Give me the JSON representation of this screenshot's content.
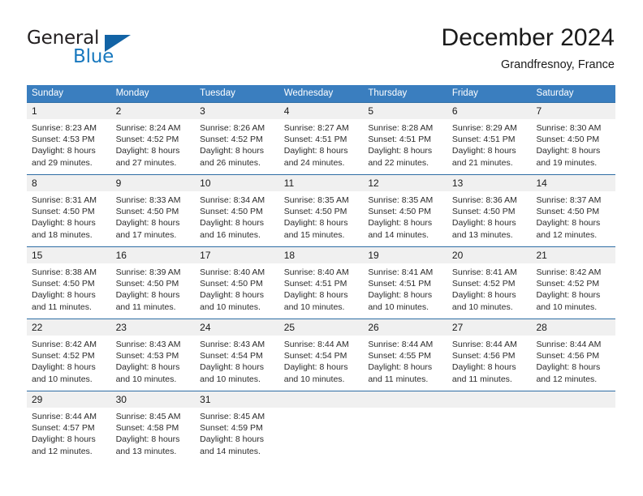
{
  "brand": {
    "name_part1": "General",
    "name_part2": "Blue",
    "colors": {
      "general": "#231f20",
      "blue": "#1878be",
      "triangle": "#1263a5",
      "header_bar": "#3a7ebf",
      "row_separator": "#2e6da4",
      "daynum_band": "#f0f0f0"
    }
  },
  "header": {
    "title": "December 2024",
    "subtitle": "Grandfresnoy, France"
  },
  "weekdays": [
    "Sunday",
    "Monday",
    "Tuesday",
    "Wednesday",
    "Thursday",
    "Friday",
    "Saturday"
  ],
  "weeks": [
    [
      {
        "day": "1",
        "sunrise": "Sunrise: 8:23 AM",
        "sunset": "Sunset: 4:53 PM",
        "daylight1": "Daylight: 8 hours",
        "daylight2": "and 29 minutes."
      },
      {
        "day": "2",
        "sunrise": "Sunrise: 8:24 AM",
        "sunset": "Sunset: 4:52 PM",
        "daylight1": "Daylight: 8 hours",
        "daylight2": "and 27 minutes."
      },
      {
        "day": "3",
        "sunrise": "Sunrise: 8:26 AM",
        "sunset": "Sunset: 4:52 PM",
        "daylight1": "Daylight: 8 hours",
        "daylight2": "and 26 minutes."
      },
      {
        "day": "4",
        "sunrise": "Sunrise: 8:27 AM",
        "sunset": "Sunset: 4:51 PM",
        "daylight1": "Daylight: 8 hours",
        "daylight2": "and 24 minutes."
      },
      {
        "day": "5",
        "sunrise": "Sunrise: 8:28 AM",
        "sunset": "Sunset: 4:51 PM",
        "daylight1": "Daylight: 8 hours",
        "daylight2": "and 22 minutes."
      },
      {
        "day": "6",
        "sunrise": "Sunrise: 8:29 AM",
        "sunset": "Sunset: 4:51 PM",
        "daylight1": "Daylight: 8 hours",
        "daylight2": "and 21 minutes."
      },
      {
        "day": "7",
        "sunrise": "Sunrise: 8:30 AM",
        "sunset": "Sunset: 4:50 PM",
        "daylight1": "Daylight: 8 hours",
        "daylight2": "and 19 minutes."
      }
    ],
    [
      {
        "day": "8",
        "sunrise": "Sunrise: 8:31 AM",
        "sunset": "Sunset: 4:50 PM",
        "daylight1": "Daylight: 8 hours",
        "daylight2": "and 18 minutes."
      },
      {
        "day": "9",
        "sunrise": "Sunrise: 8:33 AM",
        "sunset": "Sunset: 4:50 PM",
        "daylight1": "Daylight: 8 hours",
        "daylight2": "and 17 minutes."
      },
      {
        "day": "10",
        "sunrise": "Sunrise: 8:34 AM",
        "sunset": "Sunset: 4:50 PM",
        "daylight1": "Daylight: 8 hours",
        "daylight2": "and 16 minutes."
      },
      {
        "day": "11",
        "sunrise": "Sunrise: 8:35 AM",
        "sunset": "Sunset: 4:50 PM",
        "daylight1": "Daylight: 8 hours",
        "daylight2": "and 15 minutes."
      },
      {
        "day": "12",
        "sunrise": "Sunrise: 8:35 AM",
        "sunset": "Sunset: 4:50 PM",
        "daylight1": "Daylight: 8 hours",
        "daylight2": "and 14 minutes."
      },
      {
        "day": "13",
        "sunrise": "Sunrise: 8:36 AM",
        "sunset": "Sunset: 4:50 PM",
        "daylight1": "Daylight: 8 hours",
        "daylight2": "and 13 minutes."
      },
      {
        "day": "14",
        "sunrise": "Sunrise: 8:37 AM",
        "sunset": "Sunset: 4:50 PM",
        "daylight1": "Daylight: 8 hours",
        "daylight2": "and 12 minutes."
      }
    ],
    [
      {
        "day": "15",
        "sunrise": "Sunrise: 8:38 AM",
        "sunset": "Sunset: 4:50 PM",
        "daylight1": "Daylight: 8 hours",
        "daylight2": "and 11 minutes."
      },
      {
        "day": "16",
        "sunrise": "Sunrise: 8:39 AM",
        "sunset": "Sunset: 4:50 PM",
        "daylight1": "Daylight: 8 hours",
        "daylight2": "and 11 minutes."
      },
      {
        "day": "17",
        "sunrise": "Sunrise: 8:40 AM",
        "sunset": "Sunset: 4:50 PM",
        "daylight1": "Daylight: 8 hours",
        "daylight2": "and 10 minutes."
      },
      {
        "day": "18",
        "sunrise": "Sunrise: 8:40 AM",
        "sunset": "Sunset: 4:51 PM",
        "daylight1": "Daylight: 8 hours",
        "daylight2": "and 10 minutes."
      },
      {
        "day": "19",
        "sunrise": "Sunrise: 8:41 AM",
        "sunset": "Sunset: 4:51 PM",
        "daylight1": "Daylight: 8 hours",
        "daylight2": "and 10 minutes."
      },
      {
        "day": "20",
        "sunrise": "Sunrise: 8:41 AM",
        "sunset": "Sunset: 4:52 PM",
        "daylight1": "Daylight: 8 hours",
        "daylight2": "and 10 minutes."
      },
      {
        "day": "21",
        "sunrise": "Sunrise: 8:42 AM",
        "sunset": "Sunset: 4:52 PM",
        "daylight1": "Daylight: 8 hours",
        "daylight2": "and 10 minutes."
      }
    ],
    [
      {
        "day": "22",
        "sunrise": "Sunrise: 8:42 AM",
        "sunset": "Sunset: 4:52 PM",
        "daylight1": "Daylight: 8 hours",
        "daylight2": "and 10 minutes."
      },
      {
        "day": "23",
        "sunrise": "Sunrise: 8:43 AM",
        "sunset": "Sunset: 4:53 PM",
        "daylight1": "Daylight: 8 hours",
        "daylight2": "and 10 minutes."
      },
      {
        "day": "24",
        "sunrise": "Sunrise: 8:43 AM",
        "sunset": "Sunset: 4:54 PM",
        "daylight1": "Daylight: 8 hours",
        "daylight2": "and 10 minutes."
      },
      {
        "day": "25",
        "sunrise": "Sunrise: 8:44 AM",
        "sunset": "Sunset: 4:54 PM",
        "daylight1": "Daylight: 8 hours",
        "daylight2": "and 10 minutes."
      },
      {
        "day": "26",
        "sunrise": "Sunrise: 8:44 AM",
        "sunset": "Sunset: 4:55 PM",
        "daylight1": "Daylight: 8 hours",
        "daylight2": "and 11 minutes."
      },
      {
        "day": "27",
        "sunrise": "Sunrise: 8:44 AM",
        "sunset": "Sunset: 4:56 PM",
        "daylight1": "Daylight: 8 hours",
        "daylight2": "and 11 minutes."
      },
      {
        "day": "28",
        "sunrise": "Sunrise: 8:44 AM",
        "sunset": "Sunset: 4:56 PM",
        "daylight1": "Daylight: 8 hours",
        "daylight2": "and 12 minutes."
      }
    ],
    [
      {
        "day": "29",
        "sunrise": "Sunrise: 8:44 AM",
        "sunset": "Sunset: 4:57 PM",
        "daylight1": "Daylight: 8 hours",
        "daylight2": "and 12 minutes."
      },
      {
        "day": "30",
        "sunrise": "Sunrise: 8:45 AM",
        "sunset": "Sunset: 4:58 PM",
        "daylight1": "Daylight: 8 hours",
        "daylight2": "and 13 minutes."
      },
      {
        "day": "31",
        "sunrise": "Sunrise: 8:45 AM",
        "sunset": "Sunset: 4:59 PM",
        "daylight1": "Daylight: 8 hours",
        "daylight2": "and 14 minutes."
      },
      {
        "day": "",
        "sunrise": "",
        "sunset": "",
        "daylight1": "",
        "daylight2": ""
      },
      {
        "day": "",
        "sunrise": "",
        "sunset": "",
        "daylight1": "",
        "daylight2": ""
      },
      {
        "day": "",
        "sunrise": "",
        "sunset": "",
        "daylight1": "",
        "daylight2": ""
      },
      {
        "day": "",
        "sunrise": "",
        "sunset": "",
        "daylight1": "",
        "daylight2": ""
      }
    ]
  ]
}
